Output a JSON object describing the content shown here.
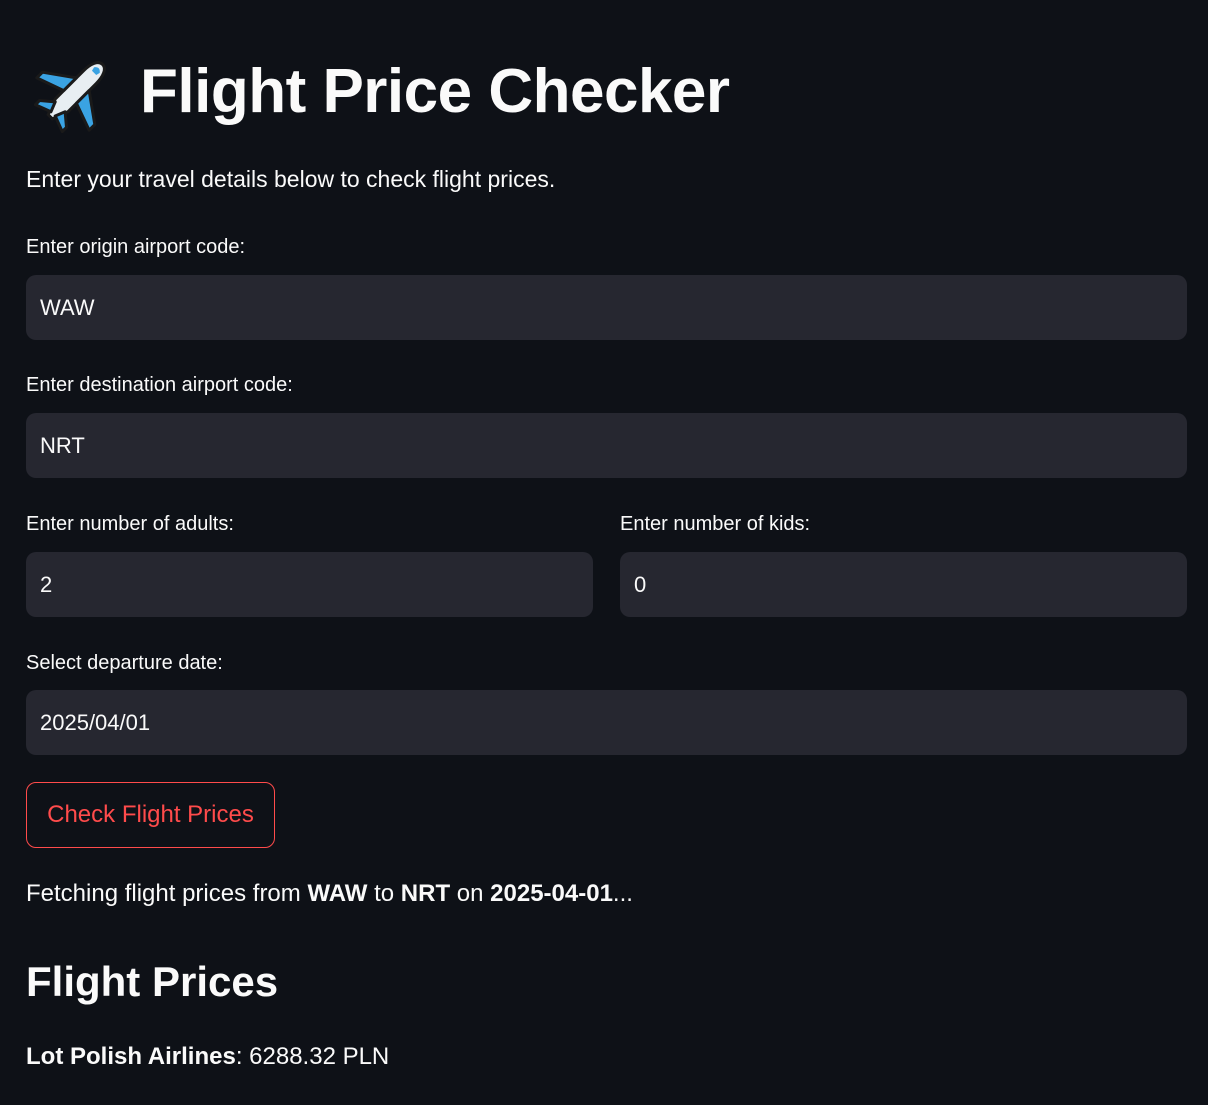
{
  "header": {
    "icon": "airplane-icon",
    "title": "Flight Price Checker"
  },
  "intro": "Enter your travel details below to check flight prices.",
  "form": {
    "origin": {
      "label": "Enter origin airport code:",
      "value": "WAW"
    },
    "destination": {
      "label": "Enter destination airport code:",
      "value": "NRT"
    },
    "adults": {
      "label": "Enter number of adults:",
      "value": "2"
    },
    "kids": {
      "label": "Enter number of kids:",
      "value": "0"
    },
    "date": {
      "label": "Select departure date:",
      "value": "2025/04/01"
    },
    "submit_label": "Check Flight Prices"
  },
  "status": {
    "prefix": "Fetching flight prices from ",
    "origin": "WAW",
    "to": " to ",
    "destination": "NRT",
    "on": " on ",
    "date": "2025-04-01",
    "suffix": "..."
  },
  "results": {
    "heading": "Flight Prices",
    "items": [
      {
        "airline": "Lot Polish Airlines",
        "separator": ": ",
        "price": "6288.32 PLN"
      }
    ]
  },
  "colors": {
    "background": "#0e1117",
    "input_bg": "#262730",
    "accent": "#ff4b4b",
    "text": "#fafafa"
  }
}
